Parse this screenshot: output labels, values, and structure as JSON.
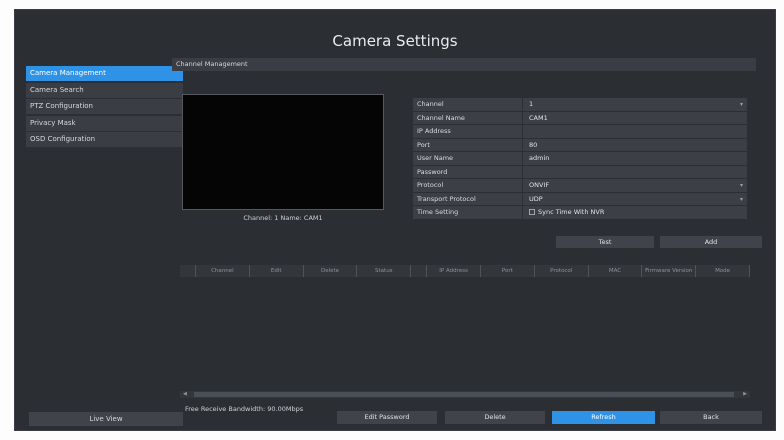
{
  "window": {
    "title": "Camera Settings"
  },
  "sidebar": {
    "items": [
      {
        "label": "Camera Management",
        "active": true
      },
      {
        "label": "Camera Search",
        "active": false
      },
      {
        "label": "PTZ Configuration",
        "active": false
      },
      {
        "label": "Privacy Mask",
        "active": false
      },
      {
        "label": "OSD Configuration",
        "active": false
      }
    ],
    "live_view_label": "Live View"
  },
  "panel": {
    "header": "Channel Management",
    "preview_caption": "Channel: 1 Name: CAM1"
  },
  "form": {
    "channel": {
      "label": "Channel",
      "value": "1"
    },
    "channel_name": {
      "label": "Channel Name",
      "value": "CAM1"
    },
    "ip_address": {
      "label": "IP Address",
      "value": ""
    },
    "port": {
      "label": "Port",
      "value": "80"
    },
    "user_name": {
      "label": "User Name",
      "value": "admin"
    },
    "password": {
      "label": "Password",
      "value": ""
    },
    "protocol": {
      "label": "Protocol",
      "value": "ONVIF"
    },
    "transport_protocol": {
      "label": "Transport Protocol",
      "value": "UDP"
    },
    "time_setting": {
      "label": "Time Setting",
      "checkbox_label": "Sync Time With NVR",
      "checked": false
    },
    "test_label": "Test",
    "add_label": "Add"
  },
  "table": {
    "columns": [
      "",
      "Channel",
      "Edit",
      "Delete",
      "Status",
      "",
      "IP Address",
      "Port",
      "Protocol",
      "MAC",
      "Firmware Version",
      "Mode"
    ]
  },
  "footer": {
    "bandwidth_text": "Free Receive Bandwidth: 90.00Mbps",
    "edit_password_label": "Edit Password",
    "delete_label": "Delete",
    "refresh_label": "Refresh",
    "back_label": "Back"
  },
  "colors": {
    "accent": "#2e93e6",
    "background": "#2b2e33",
    "row": "#3c4046"
  }
}
